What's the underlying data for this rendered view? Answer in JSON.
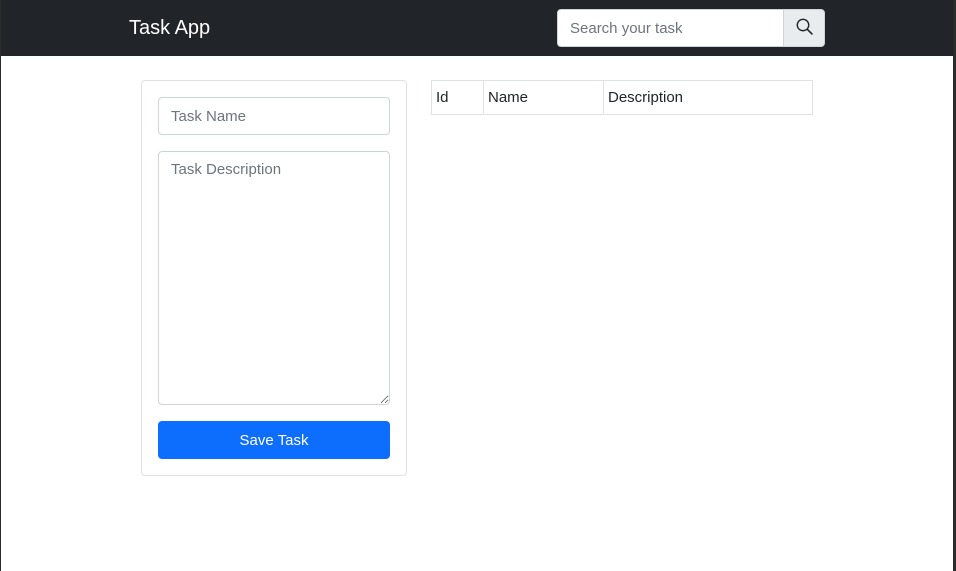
{
  "navbar": {
    "brand": "Task App",
    "search": {
      "placeholder": "Search your task",
      "value": ""
    },
    "search_button_icon": "search-icon"
  },
  "form": {
    "task_name": {
      "placeholder": "Task Name",
      "value": ""
    },
    "task_description": {
      "placeholder": "Task Description",
      "value": ""
    },
    "save_label": "Save Task"
  },
  "table": {
    "columns": [
      "Id",
      "Name",
      "Description"
    ],
    "rows": []
  },
  "colors": {
    "navbar_bg": "#212529",
    "primary": "#0d6efd",
    "border": "#dee2e6"
  }
}
